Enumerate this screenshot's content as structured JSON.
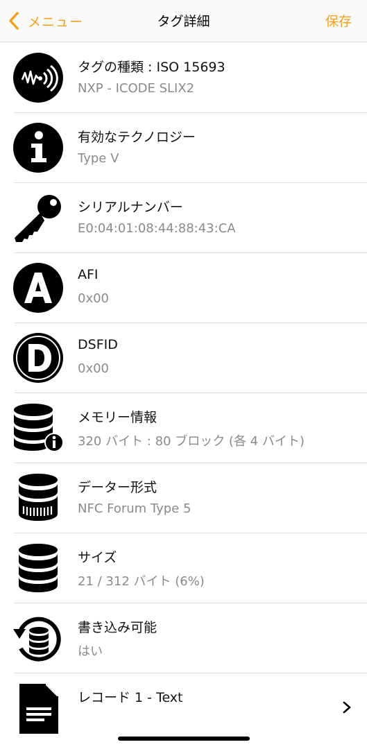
{
  "nav": {
    "back_label": "メニュー",
    "title": "タグ詳細",
    "save_label": "保存"
  },
  "rows": [
    {
      "icon": "nfc-wave-icon",
      "title": "タグの種類 : ISO 15693",
      "sub": "NXP - ICODE SLIX2"
    },
    {
      "icon": "info-icon",
      "title": "有効なテクノロジー",
      "sub": "Type V"
    },
    {
      "icon": "key-icon",
      "title": "シリアルナンバー",
      "sub": "E0:04:01:08:44:88:43:CA"
    },
    {
      "icon": "letter-a-icon",
      "title": "AFI",
      "sub": "0x00"
    },
    {
      "icon": "letter-d-icon",
      "title": "DSFID",
      "sub": "0x00"
    },
    {
      "icon": "database-info-icon",
      "title": "メモリー情報",
      "sub": "320 バイト : 80 ブロック (各 4 バイト)"
    },
    {
      "icon": "database-format-icon",
      "title": "データー形式",
      "sub": "NFC Forum Type 5"
    },
    {
      "icon": "database-icon",
      "title": "サイズ",
      "sub": "21 / 312 バイト (6%)"
    },
    {
      "icon": "database-rewrite-icon",
      "title": "書き込み可能",
      "sub": "はい"
    },
    {
      "icon": "document-icon",
      "title": "レコード 1 - Text",
      "sub": ""
    }
  ]
}
